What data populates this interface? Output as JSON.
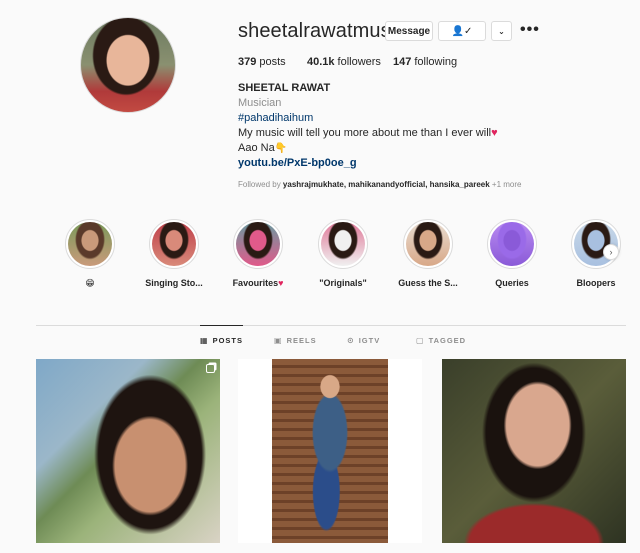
{
  "profile": {
    "username": "sheetalrawatmusic",
    "message_label": "Message",
    "follow_icon": "person-check-icon",
    "more_label": "•••",
    "stats": {
      "posts_count": "379",
      "posts_label": "posts",
      "followers_count": "40.1k",
      "followers_label": "followers",
      "following_count": "147",
      "following_label": "following"
    },
    "full_name": "SHEETAL RAWAT",
    "category": "Musician",
    "hashtag": "#pahadihaihum",
    "bio_line1": "My music will tell you more about me than I ever will",
    "bio_line2": "Aao Na",
    "bio_emoji2": "👇",
    "heart": "♥",
    "link": "youtu.be/PxE-bp0oe_g",
    "followed_by_prefix": "Followed by",
    "followed_by_names": "yashrajmukhate, mahikanandyofficial, hansika_pareek",
    "followed_by_more": "+1 more"
  },
  "highlights": [
    {
      "label": "😁",
      "colors": [
        "#c99a7a",
        "#5a3a2a",
        "#7a9a5a"
      ]
    },
    {
      "label": "Singing Sto...",
      "colors": [
        "#d98a7a",
        "#2a1a14",
        "#c0404a"
      ]
    },
    {
      "label": "Favourites",
      "heart": "♥",
      "colors": [
        "#e05a8a",
        "#2a1a14",
        "#6a9aa0"
      ]
    },
    {
      "label": "\"Originals\"",
      "colors": [
        "#f0f0f0",
        "#2a1a14",
        "#e07a9a"
      ]
    },
    {
      "label": "Guess the S...",
      "colors": [
        "#d8a888",
        "#2a1a14",
        "#e8dcd0"
      ]
    },
    {
      "label": "Queries",
      "colors": [
        "#8a5ad8",
        "#9a6ae8",
        "#b88af0"
      ]
    },
    {
      "label": "Bloopers",
      "colors": [
        "#a8c0e0",
        "#2a1a14",
        "#c8d8e8"
      ]
    }
  ],
  "tabs": [
    {
      "label": "POSTS",
      "icon": "grid-icon",
      "glyph": "▦"
    },
    {
      "label": "REELS",
      "icon": "reels-icon",
      "glyph": "▣"
    },
    {
      "label": "IGTV",
      "icon": "igtv-icon",
      "glyph": "⊙"
    },
    {
      "label": "TAGGED",
      "icon": "tagged-icon",
      "glyph": "▢"
    }
  ]
}
